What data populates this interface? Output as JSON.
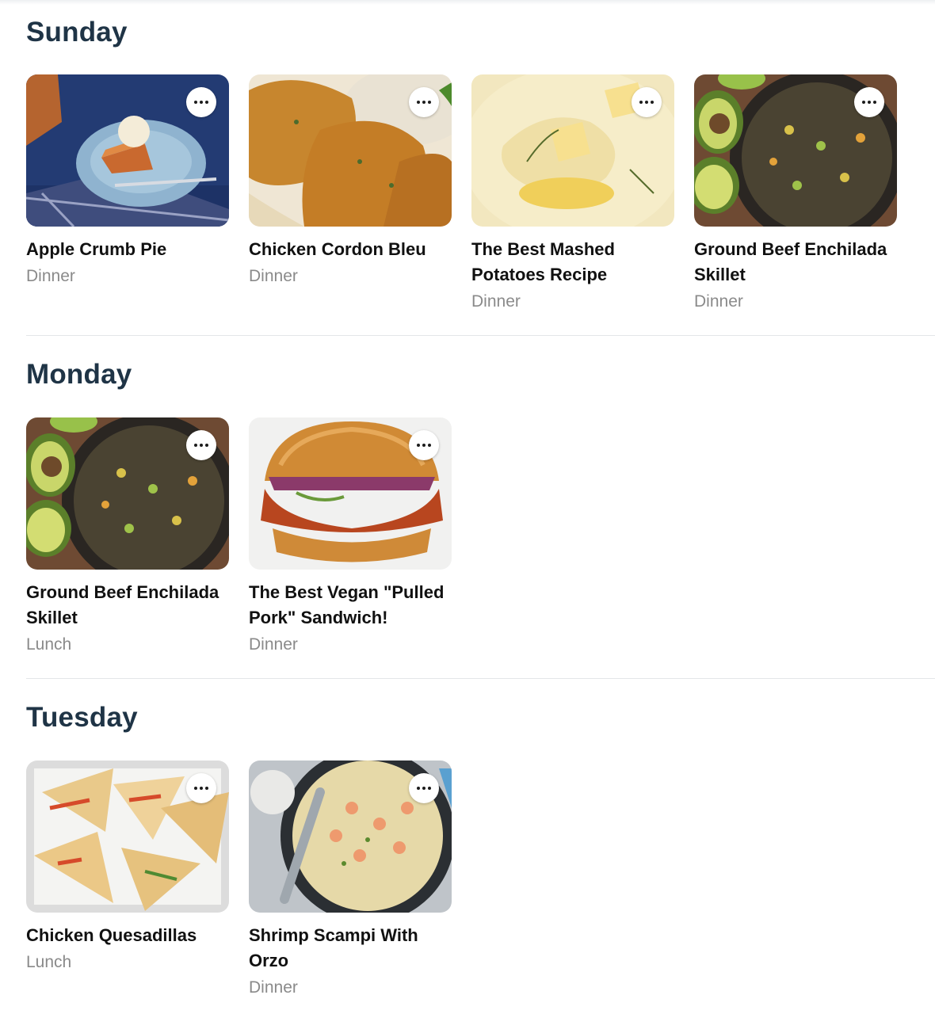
{
  "days": [
    {
      "name": "Sunday",
      "recipes": [
        {
          "title": "Apple Crumb Pie",
          "meal": "Dinner",
          "image_icon": "pie-image"
        },
        {
          "title": "Chicken Cordon Bleu",
          "meal": "Dinner",
          "image_icon": "chicken-image"
        },
        {
          "title": "The Best Mashed Potatoes Recipe",
          "meal": "Dinner",
          "image_icon": "potatoes-image"
        },
        {
          "title": "Ground Beef Enchilada Skillet",
          "meal": "Dinner",
          "image_icon": "skillet-image"
        }
      ]
    },
    {
      "name": "Monday",
      "recipes": [
        {
          "title": "Ground Beef Enchilada Skillet",
          "meal": "Lunch",
          "image_icon": "skillet-image"
        },
        {
          "title": "The Best Vegan \"Pulled Pork\" Sandwich!",
          "meal": "Dinner",
          "image_icon": "sandwich-image"
        }
      ]
    },
    {
      "name": "Tuesday",
      "recipes": [
        {
          "title": "Chicken Quesadillas",
          "meal": "Lunch",
          "image_icon": "quesadilla-image"
        },
        {
          "title": "Shrimp Scampi With Orzo",
          "meal": "Dinner",
          "image_icon": "shrimp-image"
        }
      ]
    }
  ],
  "more_button_icon": "more-dots-icon"
}
